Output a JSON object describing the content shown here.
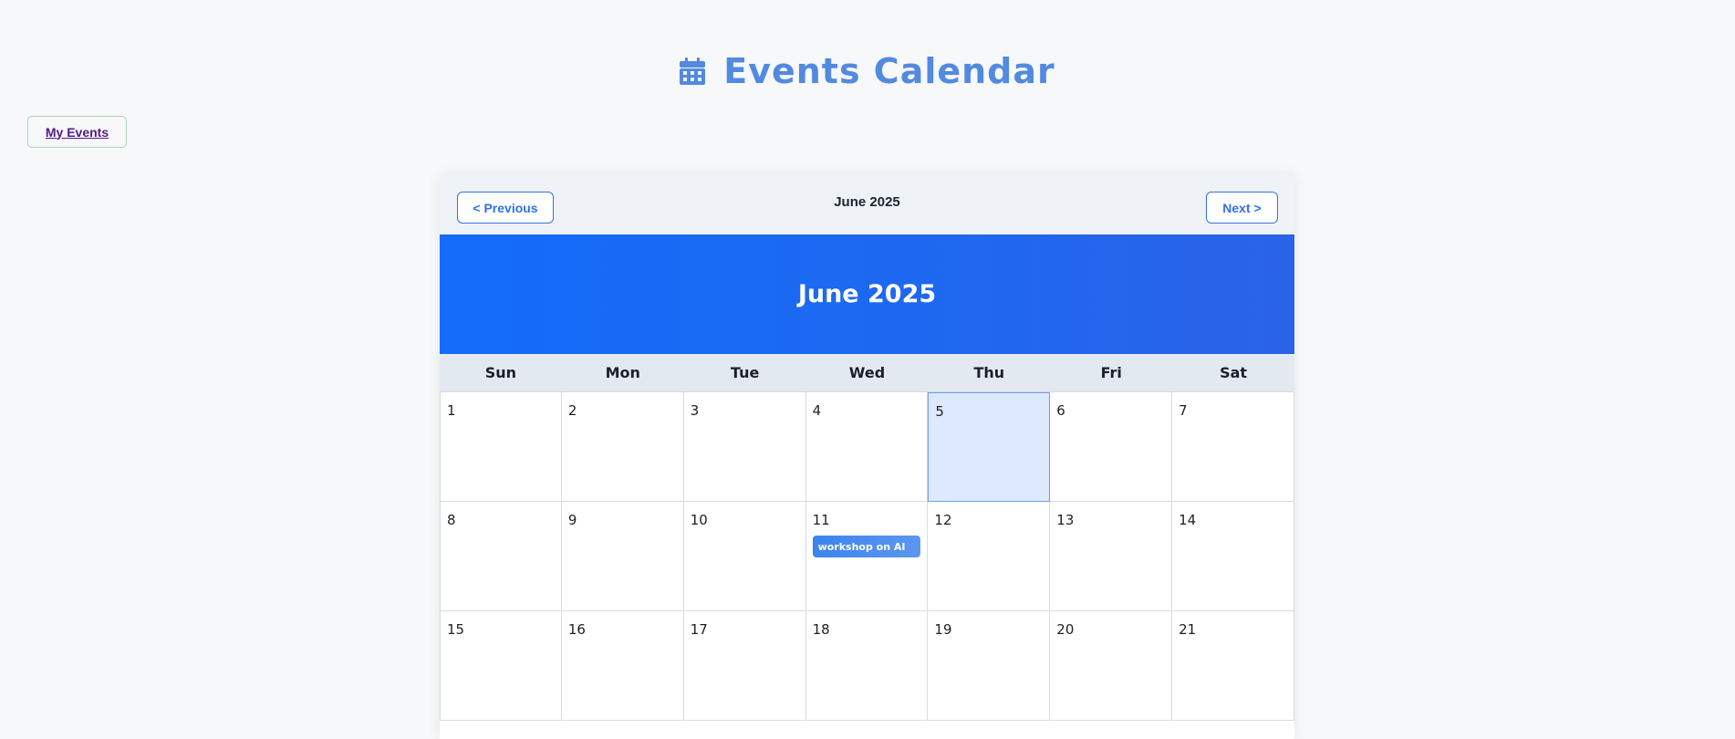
{
  "header": {
    "title": "Events Calendar",
    "icon": "calendar-icon",
    "color": "#528ae0"
  },
  "my_events_label": "My Events",
  "nav": {
    "prev_label": "< Previous",
    "next_label": "Next >",
    "month_label": "June 2025"
  },
  "banner": {
    "title": "June 2025",
    "color": "#136cfa"
  },
  "weekdays": [
    "Sun",
    "Mon",
    "Tue",
    "Wed",
    "Thu",
    "Fri",
    "Sat"
  ],
  "days": [
    {
      "num": "1"
    },
    {
      "num": "2"
    },
    {
      "num": "3"
    },
    {
      "num": "4"
    },
    {
      "num": "5",
      "today": true
    },
    {
      "num": "6"
    },
    {
      "num": "7"
    },
    {
      "num": "8"
    },
    {
      "num": "9"
    },
    {
      "num": "10"
    },
    {
      "num": "11",
      "event": "workshop on AI"
    },
    {
      "num": "12"
    },
    {
      "num": "13"
    },
    {
      "num": "14"
    },
    {
      "num": "15"
    },
    {
      "num": "16"
    },
    {
      "num": "17"
    },
    {
      "num": "18"
    },
    {
      "num": "19"
    },
    {
      "num": "20"
    },
    {
      "num": "21"
    }
  ]
}
